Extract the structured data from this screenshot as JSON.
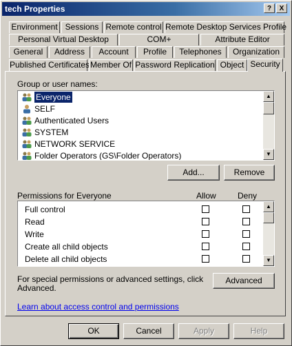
{
  "window": {
    "title": "tech Properties"
  },
  "titlebar_buttons": {
    "help": "?",
    "close": "X"
  },
  "tabs": {
    "row1": [
      "Environment",
      "Sessions",
      "Remote control",
      "Remote Desktop Services Profile"
    ],
    "row2": [
      "Personal Virtual Desktop",
      "COM+",
      "Attribute Editor"
    ],
    "row3": [
      "General",
      "Address",
      "Account",
      "Profile",
      "Telephones",
      "Organization"
    ],
    "row4": [
      "Published Certificates",
      "Member Of",
      "Password Replication",
      "Object",
      "Security"
    ]
  },
  "security": {
    "group_label": "Group or user names:",
    "users": [
      {
        "name": "Everyone",
        "icon": "users-icon",
        "selected": true
      },
      {
        "name": "SELF",
        "icon": "user-icon",
        "selected": false
      },
      {
        "name": "Authenticated Users",
        "icon": "users-icon",
        "selected": false
      },
      {
        "name": "SYSTEM",
        "icon": "users-icon",
        "selected": false
      },
      {
        "name": "NETWORK SERVICE",
        "icon": "users-icon",
        "selected": false
      },
      {
        "name": "Folder Operators (GS\\Folder Operators)",
        "icon": "users-icon",
        "selected": false
      }
    ],
    "add_button": "Add...",
    "remove_button": "Remove",
    "permissions_label": "Permissions for Everyone",
    "allow_header": "Allow",
    "deny_header": "Deny",
    "permissions": [
      {
        "name": "Full control",
        "allow": false,
        "deny": false
      },
      {
        "name": "Read",
        "allow": false,
        "deny": false
      },
      {
        "name": "Write",
        "allow": false,
        "deny": false
      },
      {
        "name": "Create all child objects",
        "allow": false,
        "deny": false
      },
      {
        "name": "Delete all child objects",
        "allow": false,
        "deny": false
      }
    ],
    "special_text_line1": "For special permissions or advanced settings, click",
    "special_text_line2": "Advanced.",
    "advanced_button": "Advanced",
    "learn_link": "Learn about access control and permissions"
  },
  "footer": {
    "ok": "OK",
    "cancel": "Cancel",
    "apply": "Apply",
    "help": "Help"
  },
  "colors": {
    "face": "#d4d0c8",
    "title_active": "#0a246a",
    "selection": "#0a246a",
    "link": "#0000ee"
  }
}
